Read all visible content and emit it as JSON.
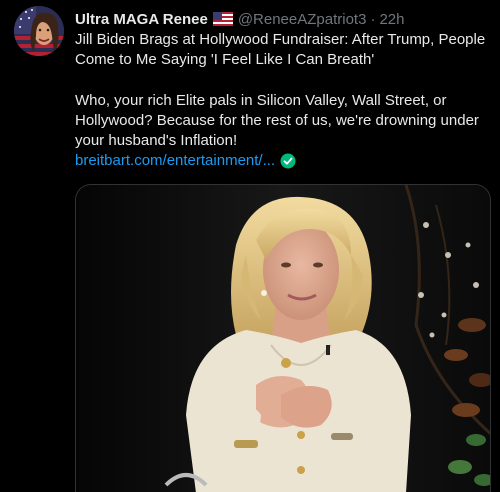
{
  "tweet": {
    "author_name": "Ultra MAGA Renee",
    "flag_icon": "us-flag-icon",
    "handle": "@ReneeAZpatriot3",
    "separator": "·",
    "time": "22h",
    "headline": "Jill Biden Brags at Hollywood Fundraiser: After Trump, People Come to Me Saying 'I Feel Like I Can Breath'",
    "comment": "Who, your rich Elite pals in Silicon Valley, Wall Street, or Hollywood? Because for the rest of us, we're drowning under your husband's Inflation!",
    "link_text": "breitbart.com/entertainment/...",
    "link_icon": "verified-check-icon"
  },
  "colors": {
    "background": "#000000",
    "text": "#e7e9ea",
    "muted": "#71767b",
    "link": "#1d9bf0",
    "verified": "#00ba7c"
  }
}
